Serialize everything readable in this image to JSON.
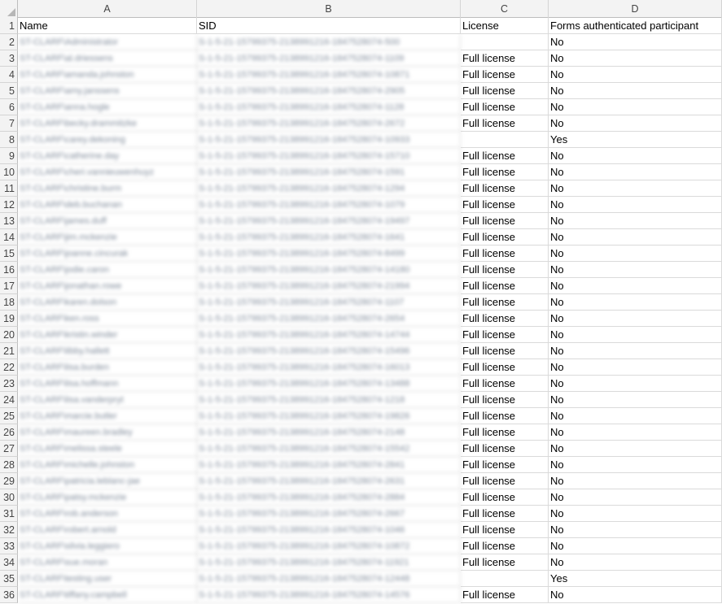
{
  "columns": [
    "A",
    "B",
    "C",
    "D"
  ],
  "rows": [
    {
      "num": "1",
      "a": "Name",
      "b": "SID",
      "c": "License",
      "d": "Forms authenticated participant"
    },
    {
      "num": "2",
      "a": "ST-CLARF\\Administrator",
      "b": "S-1-5-21-15799375-2138991216-1847528074-500",
      "c": "",
      "d": "No"
    },
    {
      "num": "3",
      "a": "ST-CLARF\\al.driessens",
      "b": "S-1-5-21-15799375-2138991216-1847528074-1109",
      "c": "Full license",
      "d": "No"
    },
    {
      "num": "4",
      "a": "ST-CLARF\\amanda.johnston",
      "b": "S-1-5-21-15799375-2138991216-1847528074-10871",
      "c": "Full license",
      "d": "No"
    },
    {
      "num": "5",
      "a": "ST-CLARF\\amy.janssens",
      "b": "S-1-5-21-15799375-2138991216-1847528074-2905",
      "c": "Full license",
      "d": "No"
    },
    {
      "num": "6",
      "a": "ST-CLARF\\anna.hogle",
      "b": "S-1-5-21-15799375-2138991216-1847528074-1128",
      "c": "Full license",
      "d": "No"
    },
    {
      "num": "7",
      "a": "ST-CLARF\\becky.drammitzke",
      "b": "S-1-5-21-15799375-2138991216-1847528074-2672",
      "c": "Full license",
      "d": "No"
    },
    {
      "num": "8",
      "a": "ST-CLARF\\carey.dekoning",
      "b": "S-1-5-21-15799375-2138991216-1847528074-10933",
      "c": "",
      "d": "Yes"
    },
    {
      "num": "9",
      "a": "ST-CLARF\\catherine.day",
      "b": "S-1-5-21-15799375-2138991216-1847528074-15710",
      "c": "Full license",
      "d": "No"
    },
    {
      "num": "10",
      "a": "ST-CLARF\\cheri.vannieuwenhuyz",
      "b": "S-1-5-21-15799375-2138991216-1847528074-1591",
      "c": "Full license",
      "d": "No"
    },
    {
      "num": "11",
      "a": "ST-CLARF\\christine.burm",
      "b": "S-1-5-21-15799375-2138991216-1847528074-1294",
      "c": "Full license",
      "d": "No"
    },
    {
      "num": "12",
      "a": "ST-CLARF\\deb.buchanan",
      "b": "S-1-5-21-15799375-2138991216-1847528074-1079",
      "c": "Full license",
      "d": "No"
    },
    {
      "num": "13",
      "a": "ST-CLARF\\james.duff",
      "b": "S-1-5-21-15799375-2138991216-1847528074-19497",
      "c": "Full license",
      "d": "No"
    },
    {
      "num": "14",
      "a": "ST-CLARF\\jim.mckenzie",
      "b": "S-1-5-21-15799375-2138991216-1847528074-1641",
      "c": "Full license",
      "d": "No"
    },
    {
      "num": "15",
      "a": "ST-CLARF\\joanne.cincurak",
      "b": "S-1-5-21-15799375-2138991216-1847528074-8499",
      "c": "Full license",
      "d": "No"
    },
    {
      "num": "16",
      "a": "ST-CLARF\\jodie.caron",
      "b": "S-1-5-21-15799375-2138991216-1847528074-14180",
      "c": "Full license",
      "d": "No"
    },
    {
      "num": "17",
      "a": "ST-CLARF\\jonathan.rowe",
      "b": "S-1-5-21-15799375-2138991216-1847528074-21994",
      "c": "Full license",
      "d": "No"
    },
    {
      "num": "18",
      "a": "ST-CLARF\\karen.dolson",
      "b": "S-1-5-21-15799375-2138991216-1847528074-1107",
      "c": "Full license",
      "d": "No"
    },
    {
      "num": "19",
      "a": "ST-CLARF\\ken.ross",
      "b": "S-1-5-21-15799375-2138991216-1847528074-2654",
      "c": "Full license",
      "d": "No"
    },
    {
      "num": "20",
      "a": "ST-CLARF\\kristin.winder",
      "b": "S-1-5-21-15799375-2138991216-1847528074-14744",
      "c": "Full license",
      "d": "No"
    },
    {
      "num": "21",
      "a": "ST-CLARF\\libby.hallett",
      "b": "S-1-5-21-15799375-2138991216-1847528074-15496",
      "c": "Full license",
      "d": "No"
    },
    {
      "num": "22",
      "a": "ST-CLARF\\lisa.burden",
      "b": "S-1-5-21-15799375-2138991216-1847528074-16013",
      "c": "Full license",
      "d": "No"
    },
    {
      "num": "23",
      "a": "ST-CLARF\\lisa.hoffmann",
      "b": "S-1-5-21-15799375-2138991216-1847528074-13488",
      "c": "Full license",
      "d": "No"
    },
    {
      "num": "24",
      "a": "ST-CLARF\\lisa.vanderpryt",
      "b": "S-1-5-21-15799375-2138991216-1847528074-1218",
      "c": "Full license",
      "d": "No"
    },
    {
      "num": "25",
      "a": "ST-CLARF\\marcie.butler",
      "b": "S-1-5-21-15799375-2138991216-1847528074-19826",
      "c": "Full license",
      "d": "No"
    },
    {
      "num": "26",
      "a": "ST-CLARF\\maureen.bradley",
      "b": "S-1-5-21-15799375-2138991216-1847528074-2148",
      "c": "Full license",
      "d": "No"
    },
    {
      "num": "27",
      "a": "ST-CLARF\\melissa.steele",
      "b": "S-1-5-21-15799375-2138991216-1847528074-15542",
      "c": "Full license",
      "d": "No"
    },
    {
      "num": "28",
      "a": "ST-CLARF\\michelle.johnston",
      "b": "S-1-5-21-15799375-2138991216-1847528074-2841",
      "c": "Full license",
      "d": "No"
    },
    {
      "num": "29",
      "a": "ST-CLARF\\patricia.leblanc-jae",
      "b": "S-1-5-21-15799375-2138991216-1847528074-2631",
      "c": "Full license",
      "d": "No"
    },
    {
      "num": "30",
      "a": "ST-CLARF\\patsy.mckenzie",
      "b": "S-1-5-21-15799375-2138991216-1847528074-2884",
      "c": "Full license",
      "d": "No"
    },
    {
      "num": "31",
      "a": "ST-CLARF\\rob.anderson",
      "b": "S-1-5-21-15799375-2138991216-1847528074-2667",
      "c": "Full license",
      "d": "No"
    },
    {
      "num": "32",
      "a": "ST-CLARF\\robert.arnold",
      "b": "S-1-5-21-15799375-2138991216-1847528074-1046",
      "c": "Full license",
      "d": "No"
    },
    {
      "num": "33",
      "a": "ST-CLARF\\silvia.leggiero",
      "b": "S-1-5-21-15799375-2138991216-1847528074-10872",
      "c": "Full license",
      "d": "No"
    },
    {
      "num": "34",
      "a": "ST-CLARF\\sue.moran",
      "b": "S-1-5-21-15799375-2138991216-1847528074-11921",
      "c": "Full license",
      "d": "No"
    },
    {
      "num": "35",
      "a": "ST-CLARF\\testing.user",
      "b": "S-1-5-21-15799375-2138991216-1847528074-12448",
      "c": "",
      "d": "Yes"
    },
    {
      "num": "36",
      "a": "ST-CLARF\\tiffany.campbell",
      "b": "S-1-5-21-15799375-2138991216-1847528074-14576",
      "c": "Full license",
      "d": "No"
    }
  ]
}
